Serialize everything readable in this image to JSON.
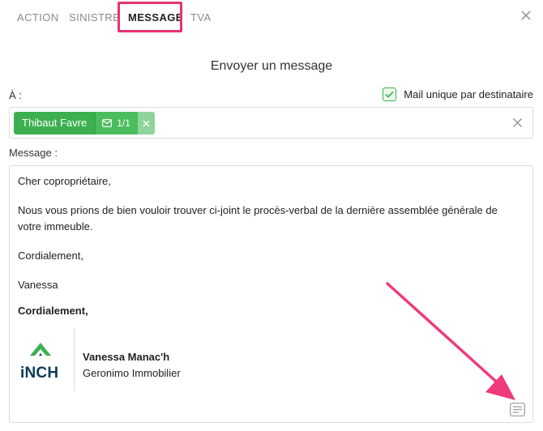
{
  "tabs": [
    {
      "label": "ACTION"
    },
    {
      "label": "SINISTRE"
    },
    {
      "label": "MESSAGE"
    },
    {
      "label": "TVA"
    }
  ],
  "active_tab": "MESSAGE",
  "dialog": {
    "title": "Envoyer un message"
  },
  "recipients": {
    "label": "À :",
    "unique_mail_label": "Mail unique par destinataire",
    "unique_mail_checked": true,
    "chips": [
      {
        "name": "Thibaut Favre",
        "count": "1/1"
      }
    ]
  },
  "message": {
    "label": "Message :",
    "greeting": "Cher copropriétaire,",
    "body": "Nous vous prions de bien vouloir trouver ci-joint le procès-verbal de la dernière assemblée générale de votre immeuble.",
    "closing": "Cordialement,",
    "sender": "Vanessa",
    "signature_closing": "Cordialement,",
    "signature": {
      "name": "Vanessa Manac'h",
      "company": "Geronimo Immobilier",
      "logo_text": "iNCH"
    }
  },
  "colors": {
    "accent_green": "#3cb04f",
    "highlight_pink": "#e8336f",
    "logo_navy": "#0e3a58"
  },
  "icons": {
    "close": "close-icon",
    "checkbox": "check-icon",
    "mail": "mail-icon",
    "template": "template-icon"
  }
}
